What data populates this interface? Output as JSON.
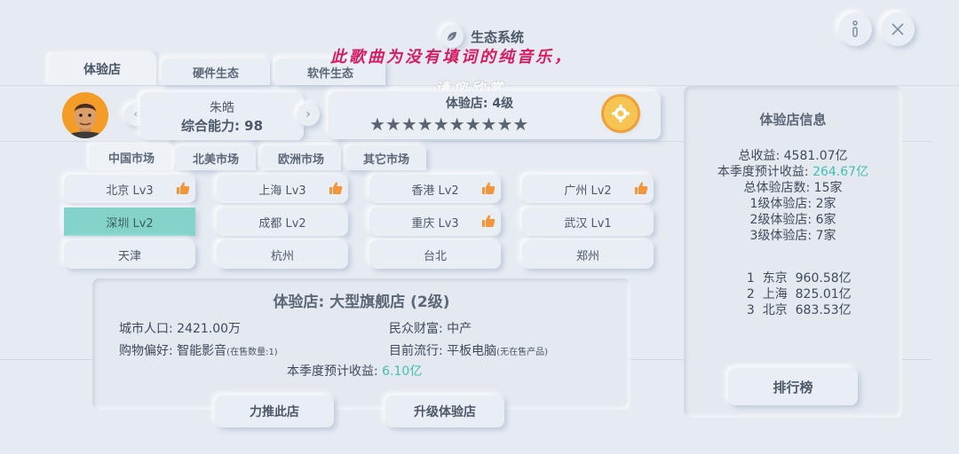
{
  "header": {
    "title": "生态系统",
    "leaf_icon": "leaf-icon",
    "info_icon": "info-icon",
    "close_icon": "close-icon"
  },
  "lyrics": {
    "line1": "此歌曲为没有填词的纯音乐，",
    "line2": "请您欣赏"
  },
  "tabs": [
    {
      "label": "体验店",
      "active": true
    },
    {
      "label": "硬件生态",
      "active": false
    },
    {
      "label": "软件生态",
      "active": false
    }
  ],
  "player": {
    "name": "朱皓",
    "ability": "综合能力: 98",
    "prev": "‹",
    "next": "›"
  },
  "store": {
    "level": "体验店: 4级",
    "stars": "★★★★★★★★★★",
    "star_count": 10,
    "upgrade_icon": "gear-badge-icon"
  },
  "markets": [
    {
      "label": "中国市场",
      "active": true
    },
    {
      "label": "北美市场",
      "active": false
    },
    {
      "label": "欧洲市场",
      "active": false
    },
    {
      "label": "其它市场",
      "active": false
    }
  ],
  "cities": [
    {
      "label": "北京 Lv3",
      "thumb": true,
      "selected": false
    },
    {
      "label": "上海 Lv3",
      "thumb": true,
      "selected": false
    },
    {
      "label": "香港 Lv2",
      "thumb": true,
      "selected": false
    },
    {
      "label": "广州 Lv2",
      "thumb": true,
      "selected": false
    },
    {
      "label": "深圳 Lv2",
      "thumb": false,
      "selected": true
    },
    {
      "label": "成都 Lv2",
      "thumb": false,
      "selected": false
    },
    {
      "label": "重庆 Lv3",
      "thumb": true,
      "selected": false
    },
    {
      "label": "武汉 Lv1",
      "thumb": false,
      "selected": false
    },
    {
      "label": "天津",
      "thumb": false,
      "selected": false
    },
    {
      "label": "杭州",
      "thumb": false,
      "selected": false
    },
    {
      "label": "台北",
      "thumb": false,
      "selected": false
    },
    {
      "label": "郑州",
      "thumb": false,
      "selected": false
    }
  ],
  "detail": {
    "title": "体验店: 大型旗舰店 (2级)",
    "population": "城市人口: 2421.00万",
    "wealth": "民众财富: 中产",
    "preference": "购物偏好: 智能影音",
    "preference_note": "(在售数量:1)",
    "trend": "目前流行: 平板电脑",
    "trend_note": "(无在售产品)",
    "income_label": "本季度预计收益: ",
    "income_value": "6.10亿",
    "push_button": "力推此店",
    "upgrade_button": "升级体验店"
  },
  "stats": {
    "title": "体验店信息",
    "total_income": "总收益: 4581.07亿",
    "season_label": "本季度预计收益: ",
    "season_value": "264.67亿",
    "store_count": "总体验店数: 15家",
    "level1": "1级体验店: 2家",
    "level2": "2级体验店: 6家",
    "level3": "3级体验店: 7家",
    "ranking": [
      {
        "rank": "1",
        "city": "东京",
        "value": "960.58亿"
      },
      {
        "rank": "2",
        "city": "上海",
        "value": "825.01亿"
      },
      {
        "rank": "3",
        "city": "北京",
        "value": "683.53亿"
      }
    ],
    "rank_button": "排行榜"
  },
  "colors": {
    "accent_teal": "#3fbfb1",
    "selected_city": "#83d3cb",
    "lyric_pink": "#d81b60",
    "thumb_orange": "#f4953a",
    "gear_yellow": "#f6c453"
  }
}
